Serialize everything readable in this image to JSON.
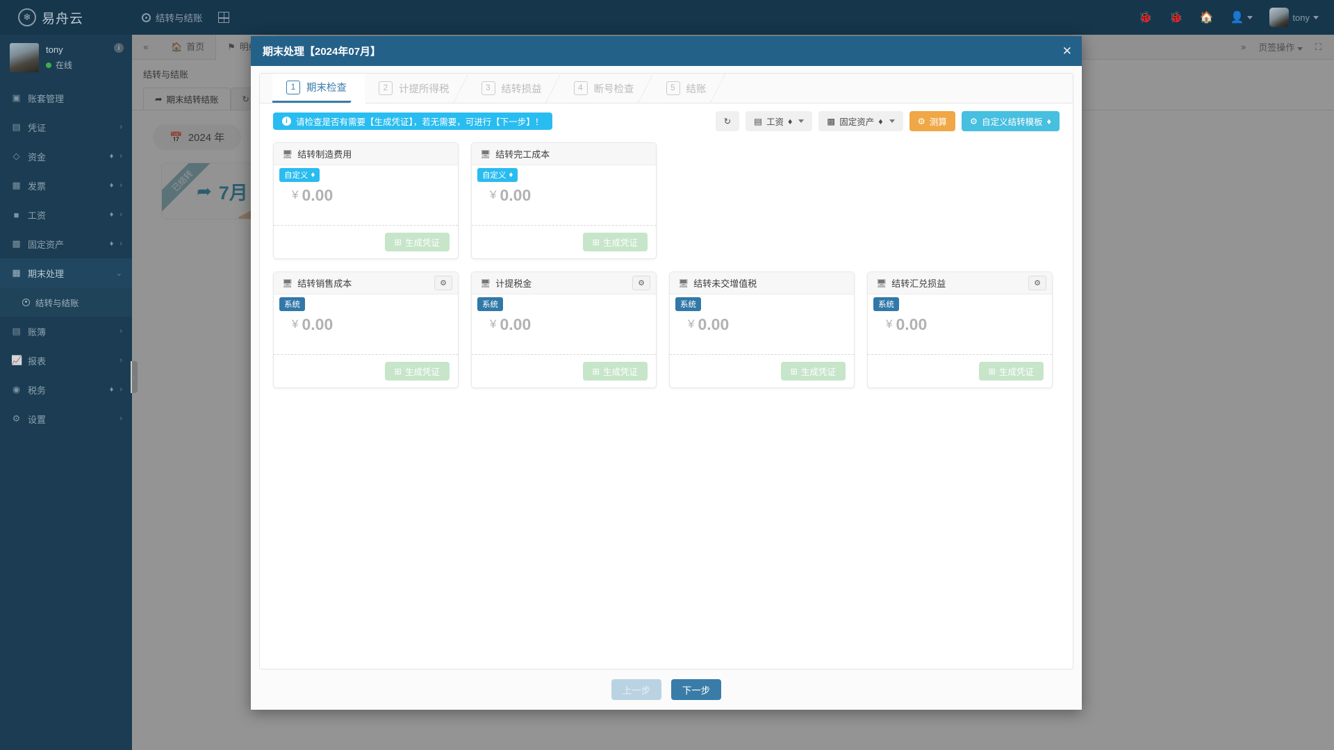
{
  "topbar": {
    "logo_text": "易舟云",
    "logo_icon": "lotus-logo-icon",
    "active_tab": "结转与结账",
    "grid_icon": "grid-add-icon",
    "icons": [
      "bug-icon",
      "bug-icon",
      "home-icon",
      "user-icon"
    ],
    "user_name": "tony"
  },
  "sidebar": {
    "user": {
      "name": "tony",
      "status": "在线",
      "info_icon": "info-icon"
    },
    "items": [
      {
        "label": "账套管理",
        "icon": "book-set-icon",
        "gem": false,
        "chevron": false,
        "active": false
      },
      {
        "label": "凭证",
        "icon": "voucher-icon",
        "gem": false,
        "chevron": true,
        "active": false
      },
      {
        "label": "资金",
        "icon": "funds-icon",
        "gem": true,
        "chevron": true,
        "active": false
      },
      {
        "label": "发票",
        "icon": "invoice-icon",
        "gem": true,
        "chevron": true,
        "active": false
      },
      {
        "label": "工资",
        "icon": "payroll-icon",
        "gem": true,
        "chevron": true,
        "active": false
      },
      {
        "label": "固定资产",
        "icon": "asset-icon",
        "gem": true,
        "chevron": true,
        "active": false
      },
      {
        "label": "期末处理",
        "icon": "calendar-icon",
        "gem": false,
        "chevron": true,
        "active": true
      }
    ],
    "sub_item": {
      "label": "结转与结账",
      "icon": "target-icon"
    },
    "items_after": [
      {
        "label": "账簿",
        "icon": "ledger-icon",
        "gem": false,
        "chevron": true
      },
      {
        "label": "报表",
        "icon": "report-chart-icon",
        "gem": false,
        "chevron": true
      },
      {
        "label": "税务",
        "icon": "tax-icon",
        "gem": true,
        "chevron": true
      },
      {
        "label": "设置",
        "icon": "gear-icon",
        "gem": true,
        "chevron": true
      }
    ],
    "collapse_icon": "collapse-handle-icon"
  },
  "content": {
    "collapse_icon": "double-left-icon",
    "tabs": [
      {
        "label": "首页",
        "icon": "home-icon",
        "active": false
      },
      {
        "label": "明细账",
        "icon": "bookmark-icon",
        "active": false
      }
    ],
    "tab_actions_label": "页签操作",
    "fullscreen_icon": "fullscreen-icon",
    "breadcrumb": "结转与结账",
    "inner_tabs": [
      {
        "label": "期末结转结账",
        "icon": "forward-arrow-icon",
        "active": true
      },
      {
        "label": "",
        "icon": "undo-icon",
        "active": false
      }
    ],
    "year_label": "2024 年",
    "year_icon": "calendar-icon",
    "month_card": {
      "ribbon": "已结转",
      "label": "7月",
      "icon": "forward-arrow-icon"
    }
  },
  "modal": {
    "title": "期末处理【2024年07月】",
    "close_icon": "close-icon",
    "steps": [
      {
        "num": "1",
        "label": "期末检查",
        "active": true
      },
      {
        "num": "2",
        "label": "计提所得税",
        "active": false
      },
      {
        "num": "3",
        "label": "结转损益",
        "active": false
      },
      {
        "num": "4",
        "label": "断号检查",
        "active": false
      },
      {
        "num": "5",
        "label": "结账",
        "active": false
      }
    ],
    "alert": {
      "icon": "info-circle-icon",
      "text": "请检查是否有需要【生成凭证】，若无需要，可进行【下一步】！"
    },
    "toolbar": [
      {
        "label": "",
        "icon": "refresh-icon",
        "style": "plain",
        "gem": false,
        "caret": false
      },
      {
        "label": "工资",
        "icon": "payroll-icon",
        "style": "plain",
        "gem": true,
        "caret": true
      },
      {
        "label": "固定资产",
        "icon": "asset-icon",
        "style": "plain",
        "gem": true,
        "caret": true
      },
      {
        "label": "测算",
        "icon": "calc-icon",
        "style": "orange",
        "gem": false,
        "caret": false
      },
      {
        "label": "自定义结转模板",
        "icon": "gear-icon",
        "style": "cyan",
        "gem": true,
        "caret": false
      }
    ],
    "cards": [
      {
        "title": "结转制造费用",
        "badge": "自定义",
        "badge_type": "custom",
        "badge_gem": true,
        "amount": "0.00",
        "currency": "¥",
        "gear": false,
        "action": "生成凭证",
        "monitor_icon": "monitor-icon"
      },
      {
        "title": "结转完工成本",
        "badge": "自定义",
        "badge_type": "custom",
        "badge_gem": true,
        "amount": "0.00",
        "currency": "¥",
        "gear": false,
        "action": "生成凭证",
        "monitor_icon": "monitor-icon"
      },
      {
        "title": "结转销售成本",
        "badge": "系统",
        "badge_type": "system",
        "badge_gem": false,
        "amount": "0.00",
        "currency": "¥",
        "gear": true,
        "action": "生成凭证",
        "monitor_icon": "monitor-icon"
      },
      {
        "title": "计提税金",
        "badge": "系统",
        "badge_type": "system",
        "badge_gem": false,
        "amount": "0.00",
        "currency": "¥",
        "gear": true,
        "action": "生成凭证",
        "monitor_icon": "monitor-icon"
      },
      {
        "title": "结转未交增值税",
        "badge": "系统",
        "badge_type": "system",
        "badge_gem": false,
        "amount": "0.00",
        "currency": "¥",
        "gear": false,
        "action": "生成凭证",
        "monitor_icon": "monitor-icon"
      },
      {
        "title": "结转汇兑损益",
        "badge": "系统",
        "badge_type": "system",
        "badge_gem": false,
        "amount": "0.00",
        "currency": "¥",
        "gear": true,
        "action": "生成凭证",
        "monitor_icon": "monitor-icon"
      }
    ],
    "footer": {
      "prev": "上一步",
      "next": "下一步"
    }
  },
  "colors": {
    "modal_header": "#246189",
    "accent_blue": "#3a7ca8",
    "info_cyan": "#29bcf0",
    "badge_system": "#3178a8",
    "orange": "#f0a745",
    "cyan_btn": "#46bfe0",
    "green_btn": "#c6e5c9",
    "sidebar": "#1b3c52",
    "topbar": "#16364c"
  }
}
